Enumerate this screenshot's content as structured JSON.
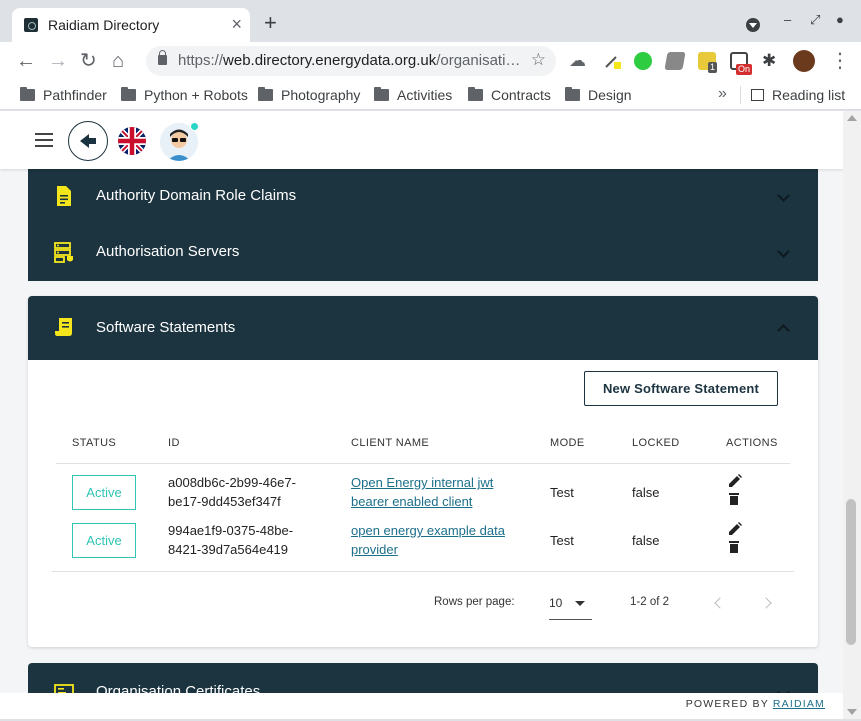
{
  "browser": {
    "tab_title": "Raidiam Directory",
    "url_prefix": "https://",
    "url_host": "web.directory.energydata.org.uk",
    "url_path": "/organisati…",
    "bookmarks": [
      "Pathfinder",
      "Python + Robots",
      "Photography",
      "Activities",
      "Contracts",
      "Design"
    ],
    "reading_list": "Reading list",
    "ext_badges": [
      "1",
      "On"
    ]
  },
  "sections": [
    {
      "label": "Authority Domain Role Claims",
      "icon": "document-icon"
    },
    {
      "label": "Authorisation Servers",
      "icon": "server-icon"
    }
  ],
  "software_statements": {
    "title": "Software Statements",
    "new_button": "New Software Statement",
    "columns": [
      "STATUS",
      "ID",
      "CLIENT NAME",
      "MODE",
      "LOCKED",
      "ACTIONS"
    ],
    "rows": [
      {
        "status": "Active",
        "id_line1": "a008db6c-2b99-46e7-",
        "id_line2": "be17-9dd453ef347f",
        "client_line1": "Open Energy internal jwt",
        "client_line2": "bearer enabled client",
        "mode": "Test",
        "locked": "false"
      },
      {
        "status": "Active",
        "id_line1": "994ae1f9-0375-48be-",
        "id_line2": "8421-39d7a564e419",
        "client_line1": "open energy example data",
        "client_line2": "provider",
        "mode": "Test",
        "locked": "false"
      }
    ],
    "pagination": {
      "rows_per_page_label": "Rows per page:",
      "rows_per_page": "10",
      "range": "1-2 of 2"
    }
  },
  "next_section": {
    "label": "Organisation Certificates"
  },
  "footer": {
    "powered_by": "POWERED BY",
    "brand": "RAIDIAM"
  },
  "colors": {
    "panel": "#1c3440",
    "accent": "#2fc4b4",
    "icon_yellow": "#f5e61c",
    "link": "#1c6f8a"
  }
}
